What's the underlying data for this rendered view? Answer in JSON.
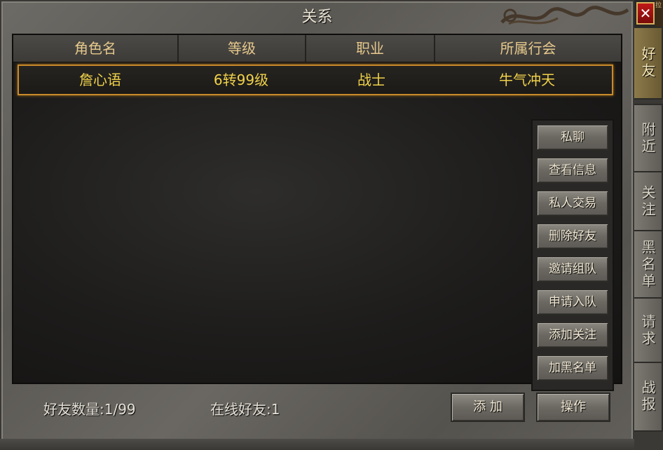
{
  "window": {
    "title": "关系",
    "close_label": "✕",
    "corner_text": "拉"
  },
  "table": {
    "columns": [
      "角色名",
      "等级",
      "职业",
      "所属行会"
    ],
    "rows": [
      {
        "name": "詹心语",
        "level": "6转99级",
        "class": "战士",
        "guild": "牛气冲天"
      }
    ]
  },
  "context_menu": {
    "items": [
      "私聊",
      "查看信息",
      "私人交易",
      "删除好友",
      "邀请组队",
      "申请入队",
      "添加关注",
      "加黑名单"
    ]
  },
  "footer": {
    "friend_count": "好友数量:1/99",
    "online_count": "在线好友:1",
    "add_button": "添 加",
    "operate_button": "操作"
  },
  "tabs": [
    "好友",
    "附近",
    "关注",
    "黑名单",
    "请求",
    "战报"
  ],
  "colors": {
    "accent": "#f0d24a",
    "selection_border": "#c88a2a",
    "close_red": "#c01818"
  }
}
